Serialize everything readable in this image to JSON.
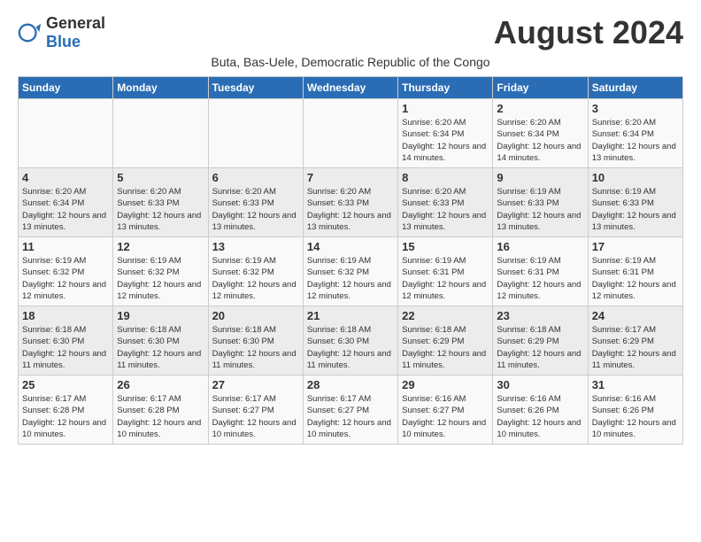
{
  "logo": {
    "general": "General",
    "blue": "Blue"
  },
  "title": "August 2024",
  "subtitle": "Buta, Bas-Uele, Democratic Republic of the Congo",
  "days_of_week": [
    "Sunday",
    "Monday",
    "Tuesday",
    "Wednesday",
    "Thursday",
    "Friday",
    "Saturday"
  ],
  "weeks": [
    [
      {
        "day": "",
        "sunrise": "",
        "sunset": "",
        "daylight": ""
      },
      {
        "day": "",
        "sunrise": "",
        "sunset": "",
        "daylight": ""
      },
      {
        "day": "",
        "sunrise": "",
        "sunset": "",
        "daylight": ""
      },
      {
        "day": "",
        "sunrise": "",
        "sunset": "",
        "daylight": ""
      },
      {
        "day": "1",
        "sunrise": "6:20 AM",
        "sunset": "6:34 PM",
        "daylight": "12 hours and 14 minutes."
      },
      {
        "day": "2",
        "sunrise": "6:20 AM",
        "sunset": "6:34 PM",
        "daylight": "12 hours and 14 minutes."
      },
      {
        "day": "3",
        "sunrise": "6:20 AM",
        "sunset": "6:34 PM",
        "daylight": "12 hours and 13 minutes."
      }
    ],
    [
      {
        "day": "4",
        "sunrise": "6:20 AM",
        "sunset": "6:34 PM",
        "daylight": "12 hours and 13 minutes."
      },
      {
        "day": "5",
        "sunrise": "6:20 AM",
        "sunset": "6:33 PM",
        "daylight": "12 hours and 13 minutes."
      },
      {
        "day": "6",
        "sunrise": "6:20 AM",
        "sunset": "6:33 PM",
        "daylight": "12 hours and 13 minutes."
      },
      {
        "day": "7",
        "sunrise": "6:20 AM",
        "sunset": "6:33 PM",
        "daylight": "12 hours and 13 minutes."
      },
      {
        "day": "8",
        "sunrise": "6:20 AM",
        "sunset": "6:33 PM",
        "daylight": "12 hours and 13 minutes."
      },
      {
        "day": "9",
        "sunrise": "6:19 AM",
        "sunset": "6:33 PM",
        "daylight": "12 hours and 13 minutes."
      },
      {
        "day": "10",
        "sunrise": "6:19 AM",
        "sunset": "6:33 PM",
        "daylight": "12 hours and 13 minutes."
      }
    ],
    [
      {
        "day": "11",
        "sunrise": "6:19 AM",
        "sunset": "6:32 PM",
        "daylight": "12 hours and 12 minutes."
      },
      {
        "day": "12",
        "sunrise": "6:19 AM",
        "sunset": "6:32 PM",
        "daylight": "12 hours and 12 minutes."
      },
      {
        "day": "13",
        "sunrise": "6:19 AM",
        "sunset": "6:32 PM",
        "daylight": "12 hours and 12 minutes."
      },
      {
        "day": "14",
        "sunrise": "6:19 AM",
        "sunset": "6:32 PM",
        "daylight": "12 hours and 12 minutes."
      },
      {
        "day": "15",
        "sunrise": "6:19 AM",
        "sunset": "6:31 PM",
        "daylight": "12 hours and 12 minutes."
      },
      {
        "day": "16",
        "sunrise": "6:19 AM",
        "sunset": "6:31 PM",
        "daylight": "12 hours and 12 minutes."
      },
      {
        "day": "17",
        "sunrise": "6:19 AM",
        "sunset": "6:31 PM",
        "daylight": "12 hours and 12 minutes."
      }
    ],
    [
      {
        "day": "18",
        "sunrise": "6:18 AM",
        "sunset": "6:30 PM",
        "daylight": "12 hours and 11 minutes."
      },
      {
        "day": "19",
        "sunrise": "6:18 AM",
        "sunset": "6:30 PM",
        "daylight": "12 hours and 11 minutes."
      },
      {
        "day": "20",
        "sunrise": "6:18 AM",
        "sunset": "6:30 PM",
        "daylight": "12 hours and 11 minutes."
      },
      {
        "day": "21",
        "sunrise": "6:18 AM",
        "sunset": "6:30 PM",
        "daylight": "12 hours and 11 minutes."
      },
      {
        "day": "22",
        "sunrise": "6:18 AM",
        "sunset": "6:29 PM",
        "daylight": "12 hours and 11 minutes."
      },
      {
        "day": "23",
        "sunrise": "6:18 AM",
        "sunset": "6:29 PM",
        "daylight": "12 hours and 11 minutes."
      },
      {
        "day": "24",
        "sunrise": "6:17 AM",
        "sunset": "6:29 PM",
        "daylight": "12 hours and 11 minutes."
      }
    ],
    [
      {
        "day": "25",
        "sunrise": "6:17 AM",
        "sunset": "6:28 PM",
        "daylight": "12 hours and 10 minutes."
      },
      {
        "day": "26",
        "sunrise": "6:17 AM",
        "sunset": "6:28 PM",
        "daylight": "12 hours and 10 minutes."
      },
      {
        "day": "27",
        "sunrise": "6:17 AM",
        "sunset": "6:27 PM",
        "daylight": "12 hours and 10 minutes."
      },
      {
        "day": "28",
        "sunrise": "6:17 AM",
        "sunset": "6:27 PM",
        "daylight": "12 hours and 10 minutes."
      },
      {
        "day": "29",
        "sunrise": "6:16 AM",
        "sunset": "6:27 PM",
        "daylight": "12 hours and 10 minutes."
      },
      {
        "day": "30",
        "sunrise": "6:16 AM",
        "sunset": "6:26 PM",
        "daylight": "12 hours and 10 minutes."
      },
      {
        "day": "31",
        "sunrise": "6:16 AM",
        "sunset": "6:26 PM",
        "daylight": "12 hours and 10 minutes."
      }
    ]
  ],
  "daylight_label": "Daylight:",
  "sunrise_label": "Sunrise:",
  "sunset_label": "Sunset:"
}
